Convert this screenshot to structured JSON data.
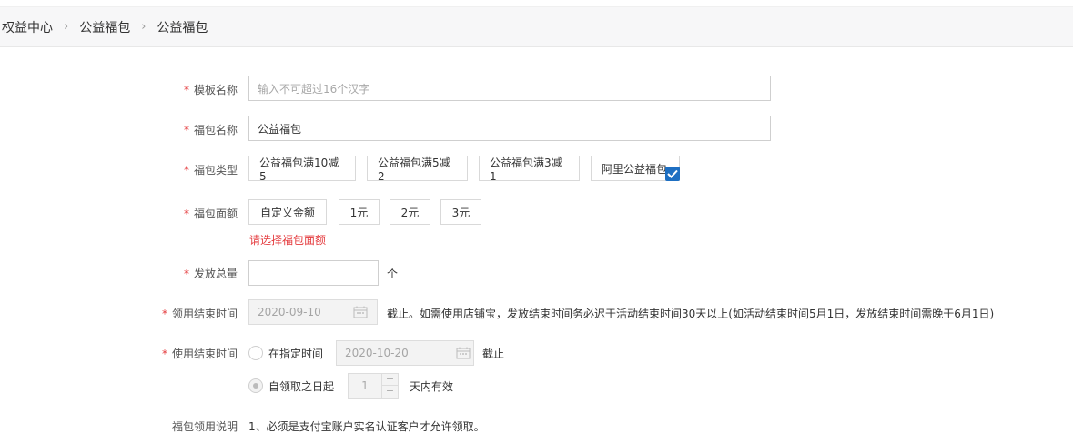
{
  "breadcrumb": [
    "权益中心",
    "公益福包",
    "公益福包"
  ],
  "form": {
    "template_name": {
      "label": "模板名称",
      "placeholder": "输入不可超过16个汉字"
    },
    "bag_name": {
      "label": "福包名称",
      "value": "公益福包"
    },
    "bag_type": {
      "label": "福包类型",
      "options": [
        "公益福包满10减5",
        "公益福包满5减2",
        "公益福包满3减1",
        "阿里公益福包"
      ]
    },
    "bag_amount": {
      "label": "福包面额",
      "options": [
        "自定义金额",
        "1元",
        "2元",
        "3元"
      ],
      "error": "请选择福包面额"
    },
    "total": {
      "label": "发放总量",
      "unit": "个"
    },
    "claim_end": {
      "label": "领用结束时间",
      "value": "2020-09-10",
      "note": "截止。如需使用店铺宝，发放结束时间务必迟于活动结束时间30天以上(如活动结束时间5月1日，发放结束时间需晚于6月1日)"
    },
    "use_end": {
      "label": "使用结束时间",
      "option1": "在指定时间",
      "date": "2020-10-20",
      "suffix": "截止",
      "option2": "自领取之日起",
      "days": "1",
      "days_suffix": "天内有效"
    },
    "instructions": {
      "label": "福包领用说明",
      "text": "1、必须是支付宝账户实名认证客户才允许领取。"
    }
  },
  "colors": {
    "required": "#e4393c",
    "check": "#1e6fc2"
  }
}
